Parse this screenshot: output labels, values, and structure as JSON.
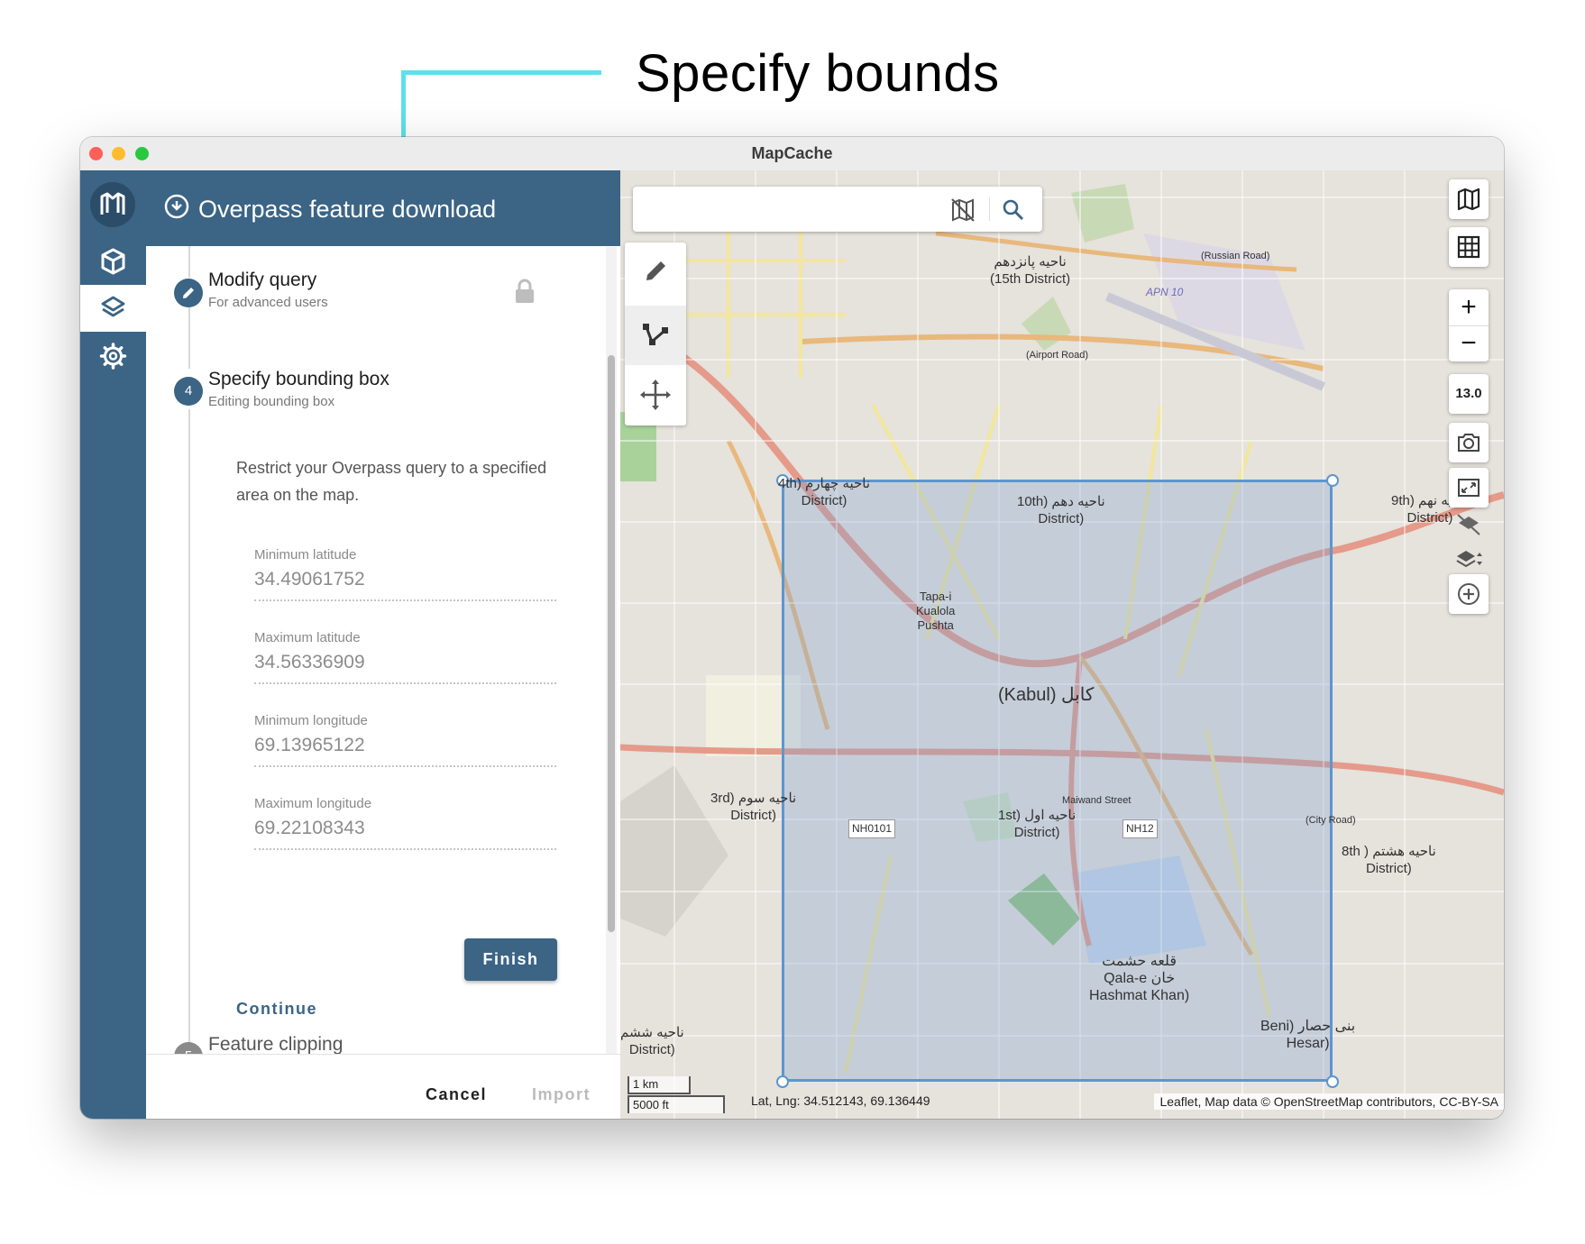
{
  "callout": {
    "title": "Specify bounds",
    "color": "#5ee0ea"
  },
  "window": {
    "title": "MapCache",
    "traffic_lights": [
      "#ff5f57",
      "#febc2e",
      "#28c840"
    ]
  },
  "nav_rail": {
    "items": [
      {
        "icon": "logo-icon"
      },
      {
        "icon": "cube-icon"
      },
      {
        "icon": "layers-icon",
        "active": true
      },
      {
        "icon": "gear-icon"
      }
    ],
    "color": "#3b6485"
  },
  "panel": {
    "title": "Overpass feature download",
    "steps": [
      {
        "title": "Modify query",
        "subtitle": "For advanced users",
        "locked": true
      },
      {
        "number": "4",
        "title": "Specify bounding box",
        "subtitle": "Editing bounding box"
      },
      {
        "number": "5",
        "title": "Feature clipping"
      }
    ],
    "description": "Restrict your Overpass query to a specified area on the map.",
    "fields": [
      {
        "label": "Minimum latitude",
        "value": "34.49061752"
      },
      {
        "label": "Maximum latitude",
        "value": "34.56336909"
      },
      {
        "label": "Minimum longitude",
        "value": "69.13965122"
      },
      {
        "label": "Maximum longitude",
        "value": "69.22108343"
      }
    ],
    "finish_label": "Finish",
    "continue_label": "Continue",
    "cancel_label": "Cancel",
    "import_label": "Import"
  },
  "map": {
    "search": {
      "placeholder": ""
    },
    "zoom_in": "+",
    "zoom_out": "−",
    "zoom_level": "13.0",
    "scale": {
      "km": "1 km",
      "ft": "5000 ft"
    },
    "coords": "Lat, Lng: 34.512143, 69.136449",
    "attribution": "Leaflet, Map data © OpenStreetMap contributors, CC-BY-SA",
    "labels": [
      {
        "text": "ناحیه پانزدهم\n(15th District)"
      },
      {
        "text": "4th) ناحیه چهارم\nDistrict)"
      },
      {
        "text": "10th) ناحیه دهم\nDistrict)"
      },
      {
        "text": "9th) ناحیه نهم\nDistrict)"
      },
      {
        "text": "Tapa-i\nKualola\nPushta"
      },
      {
        "text": "(Kabul) کابل"
      },
      {
        "text": "3rd) ناحیه سوم\nDistrict)"
      },
      {
        "text": "1st) ناحیه اول\nDistrict)"
      },
      {
        "text": "8th ) ناحیه هشتم\nDistrict)"
      },
      {
        "text": "قلعه حشمت\nQala-e خان\nHashmat Khan)"
      },
      {
        "text": "Beni) بنی حصار\nHesar)"
      },
      {
        "text": "ناحیه ششم\nDistrict)"
      },
      {
        "text": "NH0101"
      },
      {
        "text": "NH12"
      },
      {
        "text": "APN 10"
      },
      {
        "text": "(Airport Road)"
      },
      {
        "text": "(Russian Road)"
      },
      {
        "text": "Maiwand Street"
      },
      {
        "text": "(City Road)"
      }
    ],
    "bbox_color": "#5e96cf"
  }
}
